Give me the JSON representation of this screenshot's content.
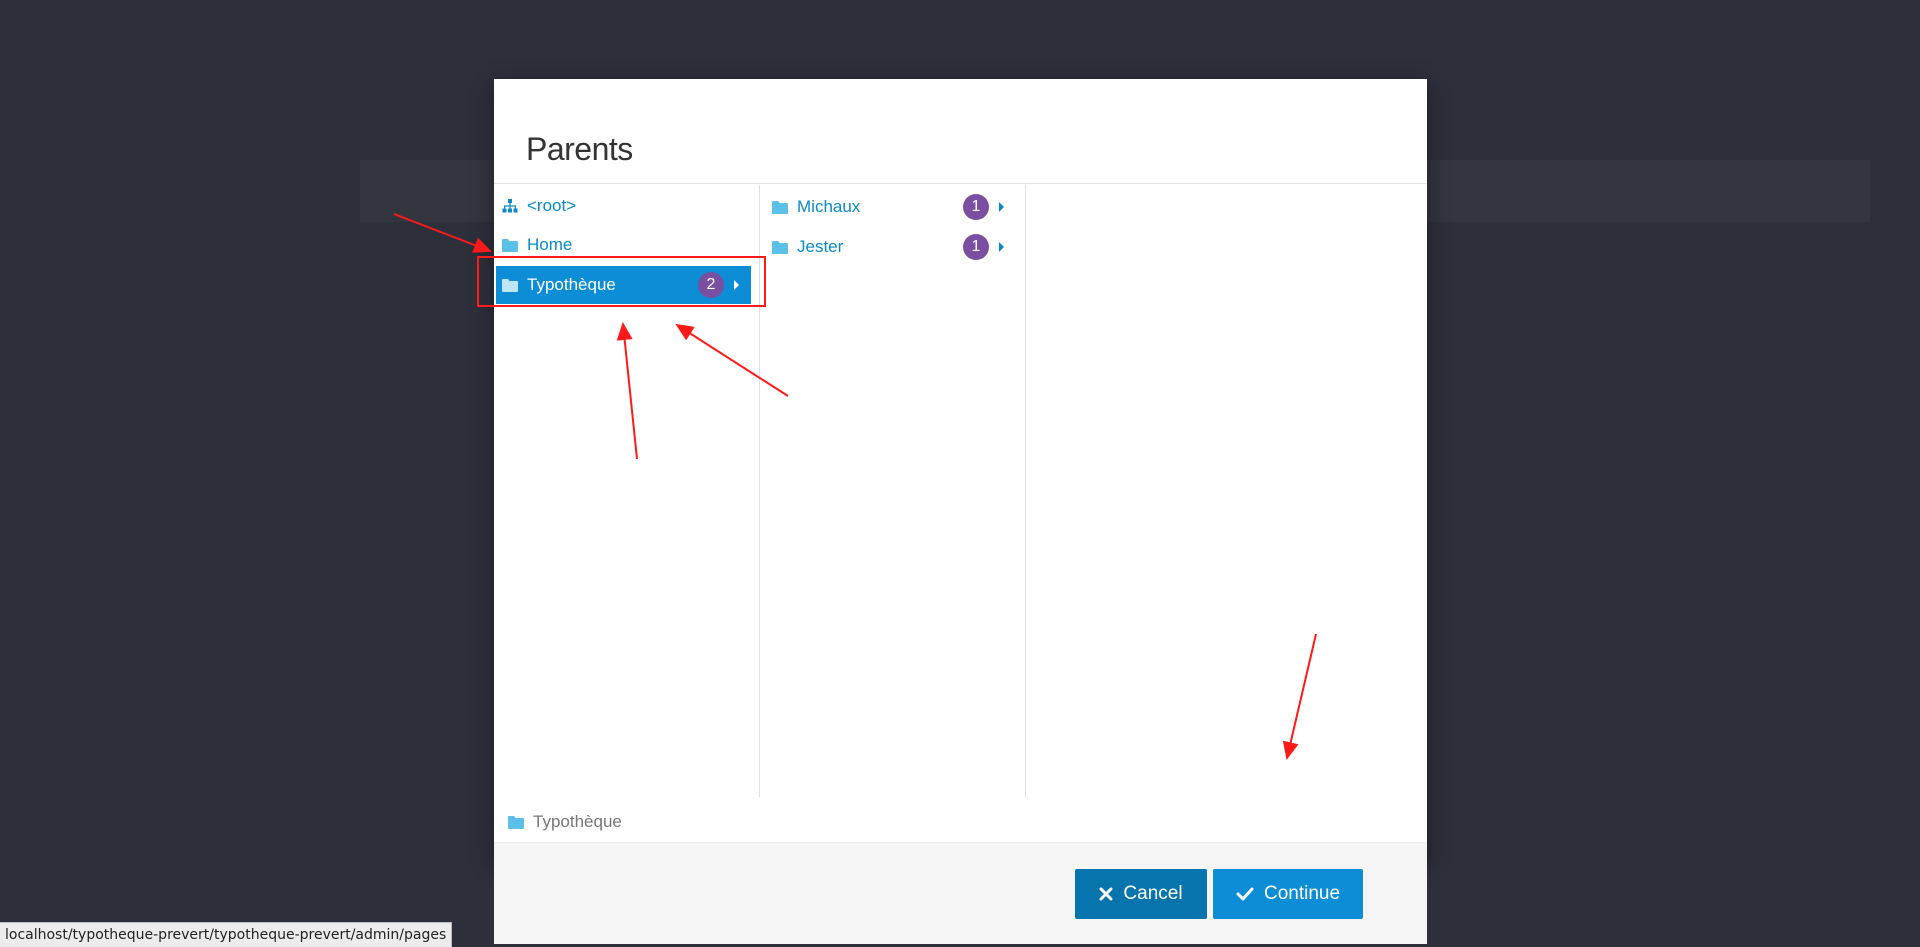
{
  "dialog": {
    "title": "Parents",
    "columns": [
      {
        "items": [
          {
            "label": "<root>",
            "icon": "sitemap-icon",
            "selected": false
          },
          {
            "label": "Home",
            "icon": "folder-icon",
            "selected": false
          },
          {
            "label": "Typothèque",
            "icon": "folder-icon",
            "selected": true,
            "badge": "2"
          }
        ]
      },
      {
        "items": [
          {
            "label": "Michaux",
            "icon": "folder-icon",
            "badge": "1"
          },
          {
            "label": "Jester",
            "icon": "folder-icon",
            "badge": "1"
          }
        ]
      },
      {
        "items": []
      }
    ],
    "selected_path": "Typothèque",
    "buttons": {
      "cancel": "Cancel",
      "continue": "Continue"
    }
  },
  "status_bar_url": "localhost/typotheque-prevert/typotheque-prevert/admin/pages",
  "colors": {
    "backdrop": "#2d2f3b",
    "accent": "#0d8dd6",
    "cancel_button": "#0874ae",
    "badge": "#7a4ea0",
    "annotation": "#ff1a1a"
  }
}
